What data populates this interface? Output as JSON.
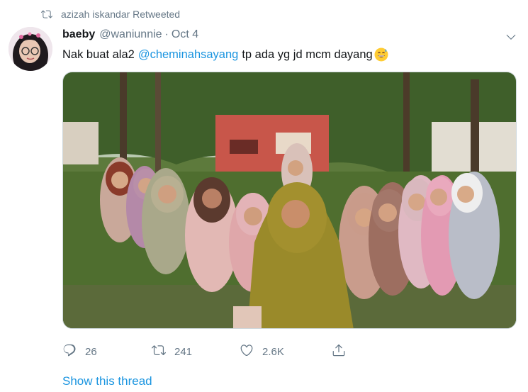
{
  "retweet": {
    "text": "azizah iskandar Retweeted",
    "icon": "retweet-icon"
  },
  "tweet": {
    "display_name": "baeby",
    "handle": "@waniunnie",
    "separator": "·",
    "date": "Oct 4",
    "text_before": "Nak buat ala2",
    "mention": "@cheminahsayang",
    "text_after": "tp ada yg jd mcm dayang",
    "emoji": "grinning-face-with-sweat"
  },
  "actions": {
    "reply_count": "26",
    "retweet_count": "241",
    "like_count": "2.6K"
  },
  "show_thread": "Show this thread",
  "colors": {
    "link": "#1b95e0",
    "muted": "#657786",
    "text": "#14171a"
  }
}
